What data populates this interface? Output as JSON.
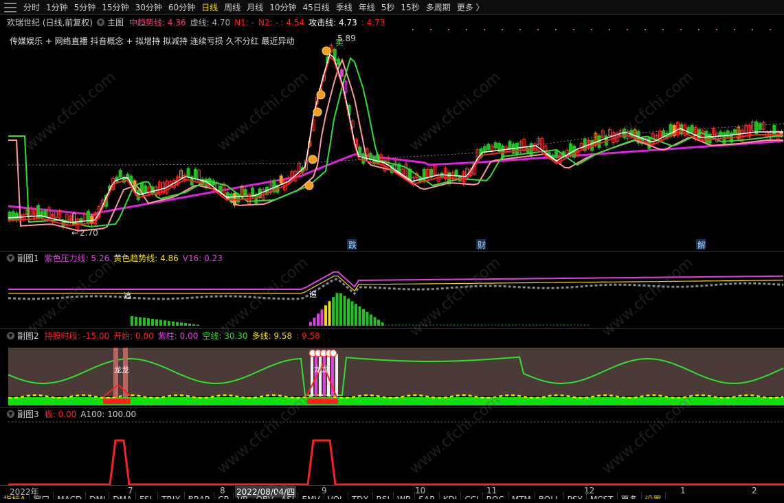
{
  "toolbar": {
    "items": [
      "分时",
      "1分钟",
      "5分钟",
      "15分钟",
      "30分钟",
      "60分钟",
      "日线",
      "周线",
      "月线",
      "10分钟",
      "45日线",
      "季线",
      "年线",
      "5秒",
      "15秒",
      "多周期",
      "更多 〉"
    ],
    "active": "日线"
  },
  "main": {
    "stock": "欢瑞世纪 (日线,前复权)",
    "label": "主图",
    "ind": [
      {
        "name": "中趋势线:",
        "value": "4.36",
        "color": "#ff3c78"
      },
      {
        "name": "虚线:",
        "value": "4.70",
        "color": "#aaaaaa"
      },
      {
        "name": "N1:",
        "value": "-",
        "color": "#ff2020"
      },
      {
        "name": "N2:",
        "value": "- : 4.54",
        "color": "#ff2020"
      },
      {
        "name": "攻击线:",
        "value": "4.73",
        "color": "#ffffff"
      },
      {
        "name": ":",
        "value": "4.73",
        "color": "#ff2020"
      }
    ],
    "concepts": "传媒娱乐 + 网络直播 抖音概念 + 拟增持 拟减持 连续亏损 久不分红 最近异动",
    "high_label": "5.89",
    "low_label": "2.70",
    "markers": [
      "跌",
      "财",
      "解"
    ],
    "sell_label": "卖"
  },
  "sub1": {
    "label": "副图1",
    "ind": [
      {
        "name": "紫色压力线:",
        "value": "5.26",
        "color": "#e040e0"
      },
      {
        "name": "黄色趋势线:",
        "value": "4.86",
        "color": "#f0e000"
      },
      {
        "name": "V16:",
        "value": "0.23",
        "color": "#e040e0"
      }
    ],
    "tag": "追"
  },
  "sub2": {
    "label": "副图2",
    "ind": [
      {
        "name": "持股时段:",
        "value": "-15.00",
        "color": "#ff2020"
      },
      {
        "name": "开始:",
        "value": "0.00",
        "color": "#ff2020"
      },
      {
        "name": "紫柱:",
        "value": "0.00",
        "color": "#e040e0"
      },
      {
        "name": "空线:",
        "value": "30.30",
        "color": "#30e030"
      },
      {
        "name": "多线:",
        "value": "9.58",
        "color": "#f0e000"
      },
      {
        "name": ":",
        "value": "9.58",
        "color": "#ff2020"
      }
    ],
    "tag": "龙"
  },
  "sub3": {
    "label": "副图3",
    "ind": [
      {
        "name": "板:",
        "value": "0.00",
        "color": "#ff2020"
      },
      {
        "name": "A100:",
        "value": "100.00",
        "color": "#cccccc"
      }
    ]
  },
  "xaxis": [
    "2022年",
    "7",
    "8",
    "2022/08/04/四",
    "9",
    "10",
    "11",
    "12",
    "1",
    "2"
  ],
  "bottom_tabs": [
    "指标A",
    "窗口",
    "MACD",
    "DMI",
    "DMA",
    "FSL",
    "TRIX",
    "BRAR",
    "CR",
    "VR",
    "OBV",
    "ASI",
    "EMV",
    "VOL",
    "TDX",
    "RSI",
    "WR",
    "SAR",
    "KDJ",
    "CCI",
    "ROC",
    "MTM",
    "BOLL",
    "PSY",
    "MCST",
    "更多",
    "设置"
  ],
  "watermark": "www.cfchi.com"
}
